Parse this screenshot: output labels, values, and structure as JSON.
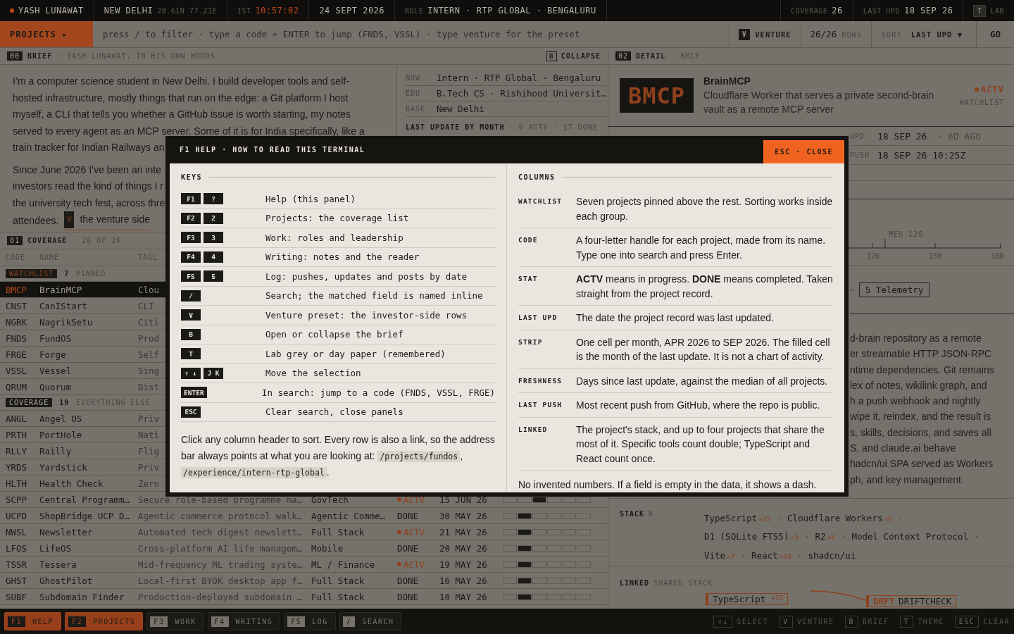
{
  "top_bar": {
    "name": "YASH LUNAWAT",
    "city": "NEW DELHI",
    "coords": "28.61N 77.21E",
    "tz": "IST",
    "time": "10:57:02",
    "date": "24 SEPT 2026",
    "role_label": "ROLE",
    "role": "INTERN · RTP GLOBAL · BENGALURU",
    "coverage_label": "COVERAGE",
    "coverage": "26",
    "last_upd_label": "LAST UPD",
    "last_upd": "18 SEP 26",
    "theme_key": "T",
    "theme_label": "LAB"
  },
  "command_bar": {
    "section": "PROJECTS ▸",
    "placeholder": "press / to filter · type a code + ENTER to jump (FNDS, VSSL) · type venture for the preset",
    "venture_key": "V",
    "venture_label": "VENTURE",
    "rows": "26/26",
    "rows_label": "ROWS",
    "sort_label": "SORT",
    "sort_value": "LAST UPD ▼",
    "go": "GO"
  },
  "brief": {
    "index": "00",
    "title": "BRIEF",
    "subtitle": "· YASH LUNAWAT, IN HIS OWN WORDS",
    "collapse_key": "B",
    "collapse_label": "COLLAPSE",
    "paragraph_lines": [
      "I’m a computer science student in New Delhi. I build developer tools and self-",
      "hosted infrastructure, mostly things that run on the edge: a Git platform I host",
      "myself, a CLI that tells you whether a GitHub issue is worth starting, my notes",
      "served to every agent as an MCP server. Some of it is for India specifically, like a",
      "train tracker for Indian Railways an"
    ],
    "lines": [
      "Since June 2026 I’ve been an inte",
      "investors read the kind of things I r",
      "the university tech fest, across thre",
      "attendees."
    ],
    "link_key": "V",
    "link": "the venture side",
    "facts": [
      {
        "label": "NOW",
        "value": "Intern · RTP Global · Bengaluru"
      },
      {
        "label": "EDU",
        "value": "B.Tech CS · Rishihood Universit…"
      },
      {
        "label": "BASE",
        "value": "New Delhi"
      }
    ],
    "month_title": "LAST UPDATE BY MONTH",
    "month_meta": "· 9 ACTV · 17 DONE"
  },
  "coverage": {
    "index": "01",
    "title": "COVERAGE",
    "subtitle": "· 26 OF 26",
    "columns": [
      "CODE",
      "NAME",
      "TAGL"
    ],
    "groups": [
      {
        "label": "WATCHLIST",
        "kind": "watchlist",
        "count": "7",
        "note": "PINNED",
        "rows": [
          {
            "code": "BMCP",
            "name": "BrainMCP",
            "tagline": "Clou",
            "selected": true
          },
          {
            "code": "CNST",
            "name": "CanIStart",
            "tagline": "CLI",
            "selected": false
          },
          {
            "code": "NGRK",
            "name": "NagrikSetu",
            "tagline": "Citi",
            "selected": false
          },
          {
            "code": "FNDS",
            "name": "FundOS",
            "tagline": "Prod",
            "selected": false
          },
          {
            "code": "FRGE",
            "name": "Forge",
            "tagline": "Self",
            "selected": false
          },
          {
            "code": "VSSL",
            "name": "Vessel",
            "tagline": "Sing",
            "selected": false
          },
          {
            "code": "QRUM",
            "name": "Quorum",
            "tagline": "Dist",
            "selected": false
          }
        ]
      },
      {
        "label": "COVERAGE",
        "kind": "coverage",
        "count": "19",
        "note": "EVERYTHING ELSE",
        "rows": [
          {
            "code": "ANGL",
            "name": "Angel OS",
            "tagline": "Priv",
            "selected": false
          },
          {
            "code": "PRTH",
            "name": "PortHole",
            "tagline": "Nati",
            "selected": false
          },
          {
            "code": "RLLY",
            "name": "Railly",
            "tagline": "Flig",
            "selected": false
          },
          {
            "code": "YRDS",
            "name": "Yardstick",
            "tagline": "Priv",
            "selected": false
          },
          {
            "code": "HLTH",
            "name": "Health Check",
            "tagline": "Zero",
            "selected": false
          },
          {
            "code": "SCPP",
            "name": "Central Programm…",
            "tagline": "Secure role-based programme ma…",
            "sector": "GovTech",
            "status": "ACTV",
            "active": true,
            "date": "15 JUN 26",
            "strip": [
              false,
              false,
              true,
              false,
              false,
              false
            ],
            "selected": false
          },
          {
            "code": "UCPD",
            "name": "ShopBridge UCP D…",
            "tagline": "Agentic commerce protocol walk…",
            "sector": "Agentic Comme…",
            "status": "DONE",
            "active": false,
            "date": "30 MAY 26",
            "strip": [
              false,
              true,
              false,
              false,
              false,
              false
            ],
            "selected": false
          },
          {
            "code": "NWSL",
            "name": "Newsletter",
            "tagline": "Automated tech digest newslett…",
            "sector": "Full Stack",
            "status": "ACTV",
            "active": true,
            "date": "21 MAY 26",
            "strip": [
              false,
              true,
              false,
              false,
              false,
              false
            ],
            "selected": false
          },
          {
            "code": "LFOS",
            "name": "LifeOS",
            "tagline": "Cross-platform AI life managem…",
            "sector": "Mobile",
            "status": "DONE",
            "active": false,
            "date": "20 MAY 26",
            "strip": [
              false,
              true,
              false,
              false,
              false,
              false
            ],
            "selected": false
          },
          {
            "code": "TSSR",
            "name": "Tessera",
            "tagline": "Mid-frequency ML trading syste…",
            "sector": "ML / Finance",
            "status": "ACTV",
            "active": true,
            "date": "19 MAY 26",
            "strip": [
              false,
              true,
              false,
              false,
              false,
              false
            ],
            "selected": false
          },
          {
            "code": "GHST",
            "name": "GhostPilot",
            "tagline": "Local-first BYOK desktop app f…",
            "sector": "Full Stack",
            "status": "DONE",
            "active": false,
            "date": "16 MAY 26",
            "strip": [
              false,
              true,
              false,
              false,
              false,
              false
            ],
            "selected": false
          },
          {
            "code": "SUBF",
            "name": "Subdomain Finder",
            "tagline": "Production-deployed subdomain …",
            "sector": "Full Stack",
            "status": "DONE",
            "active": false,
            "date": "10 MAY 26",
            "strip": [
              false,
              true,
              false,
              false,
              false,
              false
            ],
            "selected": false
          }
        ]
      }
    ]
  },
  "detail": {
    "index": "02",
    "title": "DETAIL",
    "subtitle": "· BMCP",
    "code": "BMCP",
    "name": "BrainMCP",
    "description": "Cloudflare Worker that serves a private second-brain vault as a remote MCP server",
    "status": "ACTV",
    "active": true,
    "group": "WATCHLIST",
    "stats": [
      {
        "label": "UPD",
        "value": "18 SEP 26",
        "extra": "· 6D AGO"
      },
      {
        "label": "PUSH",
        "value": "18 SEP 26 10:25Z"
      }
    ],
    "freshness": {
      "median": "MED 126",
      "ticks": [
        "120",
        "150",
        "180"
      ]
    },
    "linked_arrow": "→",
    "linked_item": "5 Telemetry",
    "description_lines": [
      "d-brain repository as a remote",
      "er streamable HTTP JSON-RPC",
      "ntime dependencies. Git remains",
      "lex of notes, wikilink graph, and",
      "h a push webhook and nightly",
      "wipe it, reindex, and the result is",
      "s, skills, decisions, and saves all",
      "S, and claude.ai behave",
      "hadcn/ui SPA served as Workers",
      "ph, and key management."
    ],
    "stack_title": "STACK",
    "stack_count": "8",
    "separator": "·",
    "stack": [
      {
        "name": "TypeScript",
        "count": "×15"
      },
      {
        "name": "Cloudflare Workers",
        "count": "×6"
      },
      {
        "name": "D1 (SQLite FTS5)",
        "count": "×5"
      },
      {
        "name": "R2",
        "count": "×4"
      },
      {
        "name": "Model Context Protocol"
      },
      {
        "name": "Vite",
        "count": "×7"
      },
      {
        "name": "React",
        "count": "×14"
      },
      {
        "name": "shadcn/ui"
      }
    ],
    "linked_title": "LINKED",
    "linked_subtitle": "SHARED STACK",
    "graph": {
      "tool": "TypeScript",
      "tool_count": "×15",
      "project_code": "DRFT",
      "project_name": "DRIFTCHECK"
    }
  },
  "help": {
    "title": "F1 HELP · HOW TO READ THIS TERMINAL",
    "close": "ESC · CLOSE",
    "keys_title": "KEYS",
    "keys": [
      {
        "keys": [
          "F1",
          "?"
        ],
        "text": "Help (this panel)"
      },
      {
        "keys": [
          "F2",
          "2"
        ],
        "text": "Projects: the coverage list"
      },
      {
        "keys": [
          "F3",
          "3"
        ],
        "text": "Work: roles and leadership"
      },
      {
        "keys": [
          "F4",
          "4"
        ],
        "text": "Writing: notes and the reader"
      },
      {
        "keys": [
          "F5",
          "5"
        ],
        "text": "Log: pushes, updates and posts by date"
      },
      {
        "keys": [
          "/"
        ],
        "text": "Search; the matched field is named inline"
      },
      {
        "keys": [
          "V"
        ],
        "text": "Venture preset: the investor-side rows"
      },
      {
        "keys": [
          "B"
        ],
        "text": "Open or collapse the brief"
      },
      {
        "keys": [
          "T"
        ],
        "text": "Lab grey or day paper (remembered)"
      },
      {
        "keys": [
          "↑ ↓",
          "J K"
        ],
        "text": "Move the selection"
      },
      {
        "keys": [
          "ENTER"
        ],
        "text": "In search: jump to a code (FNDS, VSSL, FRGE)"
      },
      {
        "keys": [
          "ESC"
        ],
        "text": "Clear search, close panels"
      }
    ],
    "note": "Click any column header to sort. Every row is also a link, so the address bar always points at what you are looking at:",
    "paths": [
      {
        "path": "/projects/fundos",
        "after": ","
      },
      {
        "path": "/experience/intern-rtp-global",
        "after": "."
      }
    ],
    "columns_title": "COLUMNS",
    "columns": [
      {
        "term": "WATCHLIST",
        "text": "Seven projects pinned above the rest. Sorting works inside each group."
      },
      {
        "term": "CODE",
        "text": "A four-letter handle for each project, made from its name. Type one into search and press Enter."
      },
      {
        "term": "STAT",
        "text": "**ACTV** means in progress. **DONE** means completed. Taken straight from the project record."
      },
      {
        "term": "LAST UPD",
        "text": "The date the project record was last updated."
      },
      {
        "term": "STRIP",
        "text": "One cell per month, APR 2026 to SEP 2026. The filled cell is the month of the last update. It is not a chart of activity."
      },
      {
        "term": "FRESHNESS",
        "text": "Days since last update, against the median of all projects."
      },
      {
        "term": "LAST PUSH",
        "text": "Most recent push from GitHub, where the repo is public."
      },
      {
        "term": "LINKED",
        "text": "The project's stack, and up to four projects that share the most of it. Specific tools count double; TypeScript and React count once."
      }
    ],
    "footer": "No invented numbers. If a field is empty in the data, it shows a dash."
  },
  "bottom_bar": {
    "tabs": [
      {
        "key": "F1",
        "label": "HELP",
        "selected": true
      },
      {
        "key": "F2",
        "label": "PROJECTS",
        "selected": true
      },
      {
        "key": "F3",
        "label": "WORK",
        "selected": false
      },
      {
        "key": "F4",
        "label": "WRITING",
        "selected": false
      },
      {
        "key": "F5",
        "label": "LOG",
        "selected": false
      },
      {
        "key": "/",
        "label": "SEARCH",
        "selected": false
      }
    ],
    "hints": [
      {
        "key": "↑↓",
        "label": "SELECT"
      },
      {
        "key": "V",
        "label": "VENTURE"
      },
      {
        "key": "B",
        "label": "BRIEF"
      },
      {
        "key": "T",
        "label": "THEME"
      },
      {
        "key": "ESC",
        "label": "CLEAR"
      }
    ]
  }
}
